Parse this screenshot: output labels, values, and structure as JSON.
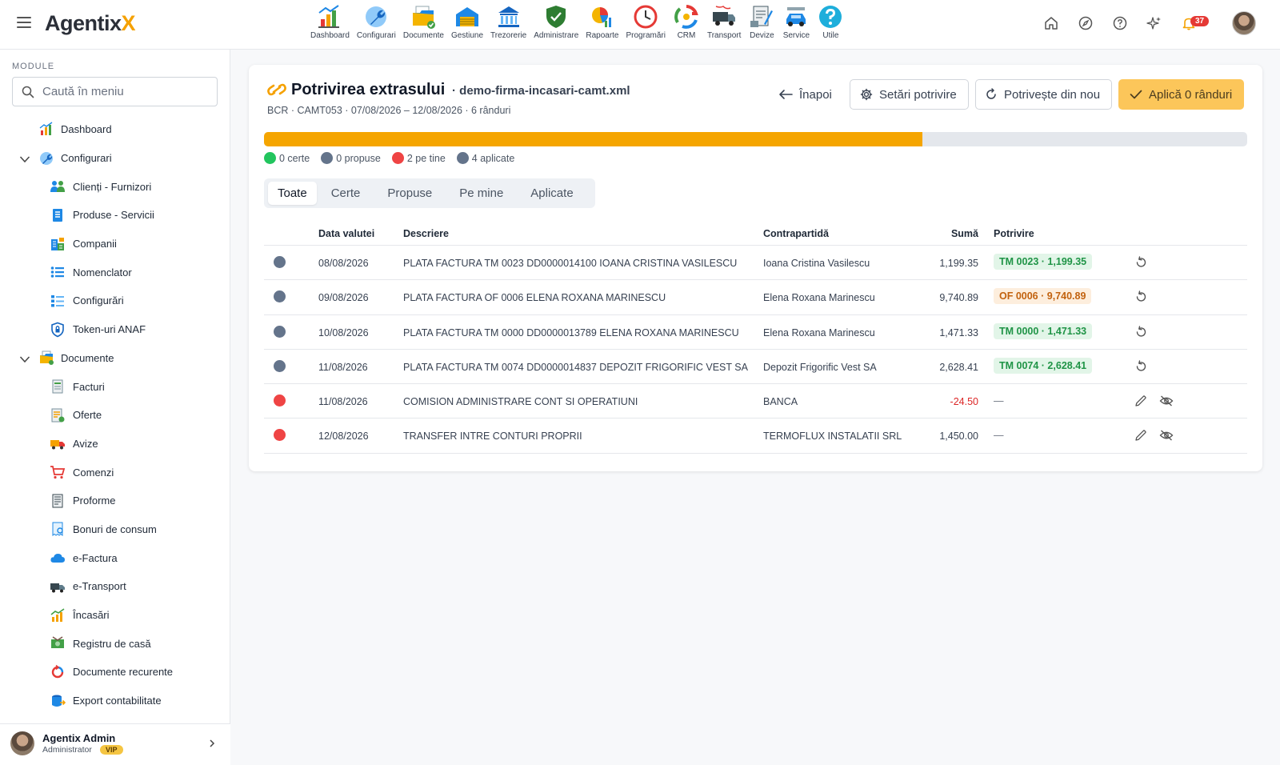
{
  "app": {
    "logo_text": "Agentix",
    "logo_accent": "X"
  },
  "topnav": [
    {
      "label": "Dashboard",
      "icon": "dashboard-icon"
    },
    {
      "label": "Configurari",
      "icon": "wrench-icon"
    },
    {
      "label": "Documente",
      "icon": "documents-icon"
    },
    {
      "label": "Gestiune",
      "icon": "warehouse-icon"
    },
    {
      "label": "Trezorerie",
      "icon": "bank-icon"
    },
    {
      "label": "Administrare",
      "icon": "shield-icon"
    },
    {
      "label": "Rapoarte",
      "icon": "report-icon"
    },
    {
      "label": "Programări",
      "icon": "clock-icon"
    },
    {
      "label": "CRM",
      "icon": "crm-icon"
    },
    {
      "label": "Transport",
      "icon": "truck-icon"
    },
    {
      "label": "Devize",
      "icon": "estimate-icon"
    },
    {
      "label": "Service",
      "icon": "car-icon"
    },
    {
      "label": "Utile",
      "icon": "help-icon"
    }
  ],
  "topright": {
    "notification_count": "37"
  },
  "sidebar": {
    "section_title": "MODULE",
    "search_placeholder": "Caută în meniu",
    "items": [
      {
        "label": "Dashboard",
        "level": 0
      },
      {
        "label": "Configurari",
        "level": 0,
        "expanded": true
      },
      {
        "label": "Clienți - Furnizori",
        "level": 1
      },
      {
        "label": "Produse - Servicii",
        "level": 1
      },
      {
        "label": "Companii",
        "level": 1
      },
      {
        "label": "Nomenclator",
        "level": 1
      },
      {
        "label": "Configurări",
        "level": 1
      },
      {
        "label": "Token-uri ANAF",
        "level": 1
      },
      {
        "label": "Documente",
        "level": 0,
        "expanded": true
      },
      {
        "label": "Facturi",
        "level": 1
      },
      {
        "label": "Oferte",
        "level": 1
      },
      {
        "label": "Avize",
        "level": 1
      },
      {
        "label": "Comenzi",
        "level": 1
      },
      {
        "label": "Proforme",
        "level": 1
      },
      {
        "label": "Bonuri de consum",
        "level": 1
      },
      {
        "label": "e-Factura",
        "level": 1
      },
      {
        "label": "e-Transport",
        "level": 1
      },
      {
        "label": "Încasări",
        "level": 1
      },
      {
        "label": "Registru de casă",
        "level": 1
      },
      {
        "label": "Documente recurente",
        "level": 1
      },
      {
        "label": "Export contabilitate",
        "level": 1
      }
    ],
    "user": {
      "name": "Agentix Admin",
      "role": "Administrator",
      "badge": "VIP"
    }
  },
  "page": {
    "title": "Potrivirea extrasului",
    "file": "· demo-firma-incasari-camt.xml",
    "subtitle": "BCR · CAMT053 · 07/08/2026 – 12/08/2026 · 6 rânduri",
    "buttons": {
      "back": "Înapoi",
      "settings": "Setări potrivire",
      "rematch": "Potrivește din nou",
      "apply": "Aplică 0 rânduri"
    },
    "progress_fraction": 0.67,
    "legend": [
      {
        "label": "0 certe",
        "color": "#22c55e"
      },
      {
        "label": "0 propuse",
        "color": "#64748b"
      },
      {
        "label": "2 pe tine",
        "color": "#ef4444"
      },
      {
        "label": "4 aplicate",
        "color": "#64748b"
      }
    ],
    "tabs": [
      "Toate",
      "Certe",
      "Propuse",
      "Pe mine",
      "Aplicate"
    ],
    "active_tab": 0,
    "table": {
      "headers": {
        "date": "Data valutei",
        "desc": "Descriere",
        "cp": "Contrapartidă",
        "sum": "Sumă",
        "match": "Potrivire"
      },
      "rows": [
        {
          "status": "#64748b",
          "date": "08/08/2026",
          "desc": "PLATA FACTURA TM 0023 DD0000014100 IOANA CRISTINA VASILESCU",
          "cp": "Ioana Cristina Vasilescu",
          "sum": "1,199.35",
          "match": "TM 0023 · 1,199.35",
          "match_style": "green",
          "actions": "undo"
        },
        {
          "status": "#64748b",
          "date": "09/08/2026",
          "desc": "PLATA FACTURA OF 0006 ELENA ROXANA MARINESCU",
          "cp": "Elena Roxana Marinescu",
          "sum": "9,740.89",
          "match": "OF 0006 · 9,740.89",
          "match_style": "orange",
          "actions": "undo"
        },
        {
          "status": "#64748b",
          "date": "10/08/2026",
          "desc": "PLATA FACTURA TM 0000 DD0000013789 ELENA ROXANA MARINESCU",
          "cp": "Elena Roxana Marinescu",
          "sum": "1,471.33",
          "match": "TM 0000 · 1,471.33",
          "match_style": "green",
          "actions": "undo"
        },
        {
          "status": "#64748b",
          "date": "11/08/2026",
          "desc": "PLATA FACTURA TM 0074 DD0000014837 DEPOZIT FRIGORIFIC VEST SA",
          "cp": "Depozit Frigorific Vest SA",
          "sum": "2,628.41",
          "match": "TM 0074 · 2,628.41",
          "match_style": "green",
          "actions": "undo"
        },
        {
          "status": "#ef4444",
          "date": "11/08/2026",
          "desc": "COMISION ADMINISTRARE CONT SI OPERATIUNI",
          "cp": "BANCA",
          "sum": "-24.50",
          "match": "—",
          "match_style": "none",
          "actions": "edit-hide"
        },
        {
          "status": "#ef4444",
          "date": "12/08/2026",
          "desc": "TRANSFER INTRE CONTURI PROPRII",
          "cp": "TERMOFLUX INSTALATII SRL",
          "sum": "1,450.00",
          "match": "—",
          "match_style": "none",
          "actions": "edit-hide"
        }
      ]
    }
  }
}
